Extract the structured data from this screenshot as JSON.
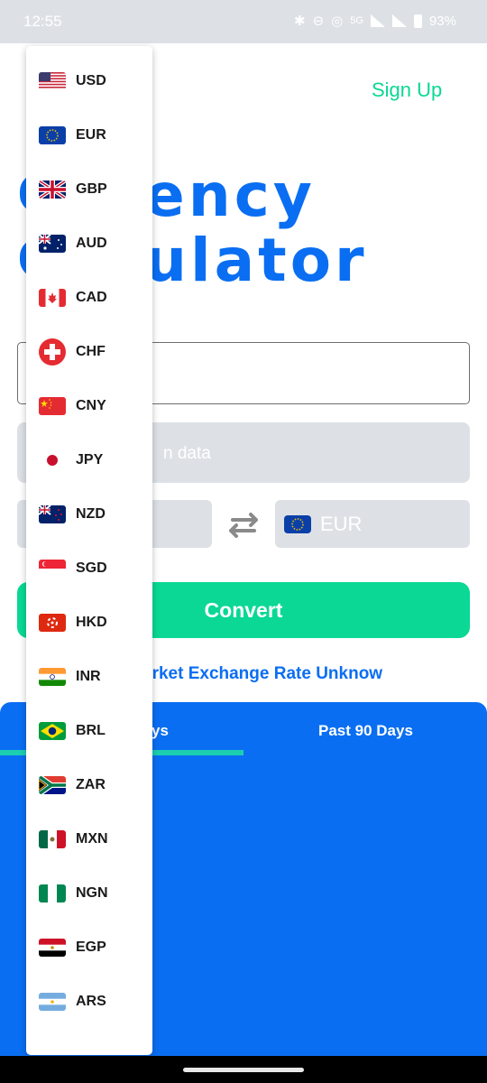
{
  "status_bar": {
    "time": "12:55",
    "network": "5G",
    "battery": "93%"
  },
  "header": {
    "signup_label": "Sign Up"
  },
  "title": {
    "line1": "ency",
    "line2": "ulator"
  },
  "info": {
    "text": "n data"
  },
  "converter": {
    "to_currency": "EUR",
    "convert_label": "Convert"
  },
  "rate_text": "arket Exchange Rate Unknow",
  "chart_tabs": {
    "tab_30": "ys",
    "tab_90": "Past 90 Days"
  },
  "currency_dropdown": {
    "items": [
      {
        "code": "USD",
        "flag_icon": "us-flag-icon"
      },
      {
        "code": "EUR",
        "flag_icon": "eu-flag-icon"
      },
      {
        "code": "GBP",
        "flag_icon": "uk-flag-icon"
      },
      {
        "code": "AUD",
        "flag_icon": "australia-flag-icon"
      },
      {
        "code": "CAD",
        "flag_icon": "canada-flag-icon"
      },
      {
        "code": "CHF",
        "flag_icon": "switzerland-flag-icon"
      },
      {
        "code": "CNY",
        "flag_icon": "china-flag-icon"
      },
      {
        "code": "JPY",
        "flag_icon": "japan-flag-icon"
      },
      {
        "code": "NZD",
        "flag_icon": "new-zealand-flag-icon"
      },
      {
        "code": "SGD",
        "flag_icon": "singapore-flag-icon"
      },
      {
        "code": "HKD",
        "flag_icon": "hong-kong-flag-icon"
      },
      {
        "code": "INR",
        "flag_icon": "india-flag-icon"
      },
      {
        "code": "BRL",
        "flag_icon": "brazil-flag-icon"
      },
      {
        "code": "ZAR",
        "flag_icon": "south-africa-flag-icon"
      },
      {
        "code": "MXN",
        "flag_icon": "mexico-flag-icon"
      },
      {
        "code": "NGN",
        "flag_icon": "nigeria-flag-icon"
      },
      {
        "code": "EGP",
        "flag_icon": "egypt-flag-icon"
      },
      {
        "code": "ARS",
        "flag_icon": "argentina-flag-icon"
      }
    ]
  },
  "colors": {
    "primary_blue": "#0a6ef2",
    "accent_green": "#0ad894",
    "tab_indicator": "#1ccfb1",
    "field_gray": "#dde1e6"
  }
}
